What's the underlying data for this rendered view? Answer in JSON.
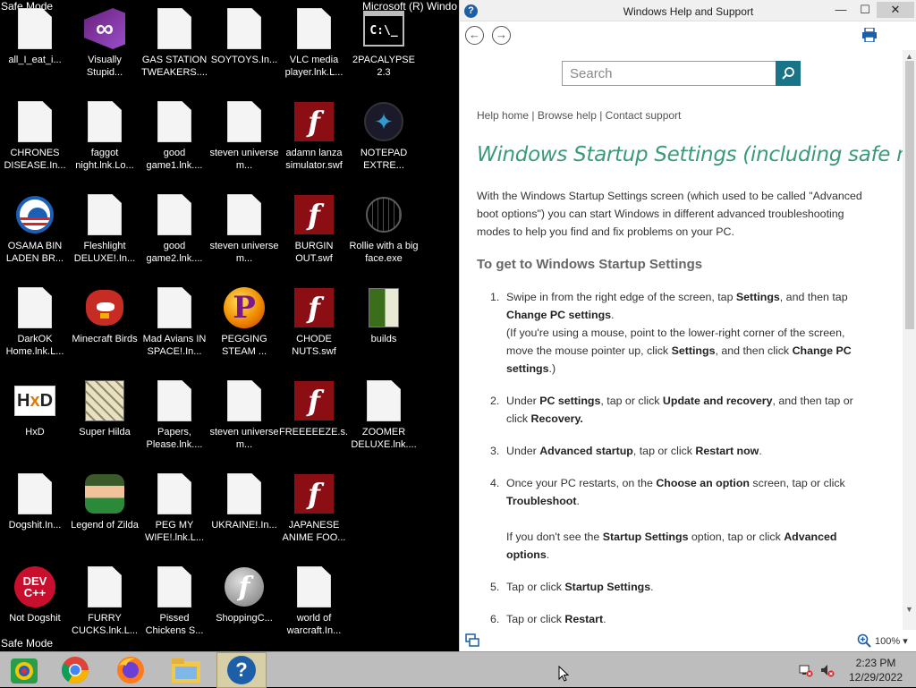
{
  "desktop": {
    "safe_mode_top": "Safe Mode",
    "safe_mode_bottom": "Safe Mode",
    "stray_title": "Microsoft (R) Windo",
    "icons": [
      {
        "label": "all_I_eat_i...",
        "icon": "document"
      },
      {
        "label": "Visually Stupid...",
        "icon": "visual-studio"
      },
      {
        "label": "GAS STATION TWEAKERS....",
        "icon": "document"
      },
      {
        "label": "SOYTOYS.In...",
        "icon": "document"
      },
      {
        "label": "VLC media player.lnk.L...",
        "icon": "document"
      },
      {
        "label": "2PACALYPSE 2.3",
        "icon": "command-prompt"
      },
      {
        "label": "CHRONES DISEASE.In...",
        "icon": "document"
      },
      {
        "label": "faggot night.lnk.Lo...",
        "icon": "document"
      },
      {
        "label": "good game1.lnk....",
        "icon": "document"
      },
      {
        "label": "steven universe m...",
        "icon": "document"
      },
      {
        "label": "adamn lanza simulator.swf",
        "icon": "flash"
      },
      {
        "label": "NOTEPAD EXTRE...",
        "icon": "notepad"
      },
      {
        "label": "OSAMA BIN LADEN BR...",
        "icon": "obama-logo"
      },
      {
        "label": "Fleshlight DELUXE!.In...",
        "icon": "document"
      },
      {
        "label": "good game2.lnk....",
        "icon": "document"
      },
      {
        "label": "steven universe m...",
        "icon": "document"
      },
      {
        "label": "BURGIN OUT.swf",
        "icon": "flash"
      },
      {
        "label": "Rollie with a big face.exe",
        "icon": "globe"
      },
      {
        "label": "DarkOK Home.lnk.L...",
        "icon": "document"
      },
      {
        "label": "Minecraft Birds",
        "icon": "angry-bird"
      },
      {
        "label": "Mad Avians IN SPACE!.In...",
        "icon": "document"
      },
      {
        "label": "PEGGING STEAM ...",
        "icon": "pegg"
      },
      {
        "label": "CHODE NUTS.swf",
        "icon": "flash"
      },
      {
        "label": "builds",
        "icon": "folder"
      },
      {
        "label": "HxD",
        "icon": "hxd"
      },
      {
        "label": "Super Hilda",
        "icon": "hilda"
      },
      {
        "label": "Papers, Please.lnk....",
        "icon": "document"
      },
      {
        "label": "steven universe m...",
        "icon": "document"
      },
      {
        "label": "FREEEEEZE.s...",
        "icon": "flash"
      },
      {
        "label": "ZOOMER DELUXE.lnk....",
        "icon": "document"
      },
      {
        "label": "Dogshit.In...",
        "icon": "document"
      },
      {
        "label": "Legend of Zilda",
        "icon": "zilda"
      },
      {
        "label": "PEG MY WIFE!.lnk.L...",
        "icon": "document"
      },
      {
        "label": "UKRAINE!.In...",
        "icon": "document"
      },
      {
        "label": "JAPANESE ANIME FOO...",
        "icon": "flash"
      },
      {
        "label": "",
        "icon": "none"
      },
      {
        "label": "Not Dogshit",
        "icon": "dev-cpp"
      },
      {
        "label": "FURRY CUCKS.lnk.L...",
        "icon": "document"
      },
      {
        "label": "Pissed Chickens S...",
        "icon": "document"
      },
      {
        "label": "ShoppingC...",
        "icon": "flash-globe"
      },
      {
        "label": "world of warcraft.In...",
        "icon": "document"
      }
    ]
  },
  "help_window": {
    "title": "Windows Help and Support",
    "buttons": {
      "minimize": "—",
      "maximize": "☐",
      "close": "✕"
    },
    "search_placeholder": "Search",
    "links": {
      "home": "Help home",
      "browse": "Browse help",
      "contact": "Contact support",
      "sep": " | "
    },
    "heading": "Windows Startup Settings (including safe mode)",
    "intro": "With the Windows Startup Settings screen (which used to be called \"Advanced boot options\") you can start Windows in different advanced troubleshooting modes to help you find and fix problems on your PC.",
    "subheading": "To get to Windows Startup Settings",
    "steps": [
      {
        "num": "1.",
        "t1": "Swipe in from the right edge of the screen, tap ",
        "b1": "Settings",
        "t2": ", and then tap ",
        "b2": "Change PC settings",
        "t3": ".",
        "t4": "(If you're using a mouse, point to the lower-right corner of the screen, move the mouse pointer up, click ",
        "b3": "Settings",
        "t5": ", and then click ",
        "b4": "Change PC settings",
        "t6": ".)"
      },
      {
        "num": "2.",
        "t1": "Under ",
        "b1": "PC settings",
        "t2": ", tap or click ",
        "b2": "Update and recovery",
        "t3": ", and then tap or click ",
        "b3": "Recovery.",
        "t4": ""
      },
      {
        "num": "3.",
        "t1": "Under ",
        "b1": "Advanced startup",
        "t2": ", tap or click ",
        "b2": "Restart now",
        "t3": "."
      },
      {
        "num": "4.",
        "t1": "Once your PC restarts, on the ",
        "b1": "Choose an option",
        "t2": " screen, tap or click ",
        "b2": "Troubleshoot",
        "t3": ".",
        "t4": "If you don't see the ",
        "b3": "Startup Settings",
        "t5": " option, tap or click ",
        "b4": "Advanced options",
        "t6": "."
      },
      {
        "num": "5.",
        "t1": "Tap or click ",
        "b1": "Startup Settings",
        "t2": "."
      },
      {
        "num": "6.",
        "t1": "Tap or click ",
        "b1": "Restart",
        "t2": "."
      }
    ],
    "zoom": "100%"
  },
  "taskbar": {
    "apps": [
      "paint-icon",
      "chrome-icon",
      "firefox-icon",
      "file-explorer-icon",
      "help-icon"
    ],
    "time": "2:23 PM",
    "date": "12/29/2022"
  }
}
